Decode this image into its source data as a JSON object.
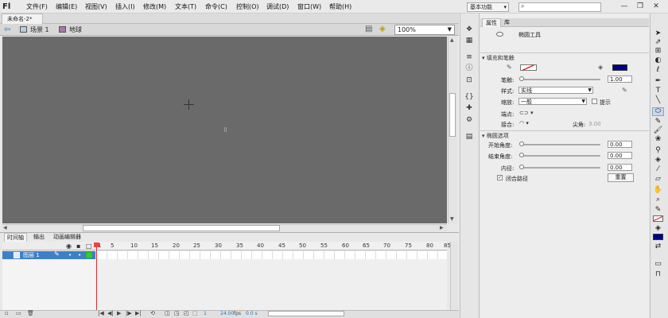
{
  "app": {
    "logo": "Fl"
  },
  "menu": [
    "文件(F)",
    "编辑(E)",
    "视图(V)",
    "插入(I)",
    "修改(M)",
    "文本(T)",
    "命令(C)",
    "控制(O)",
    "调试(D)",
    "窗口(W)",
    "帮助(H)"
  ],
  "header": {
    "workspace": "基本功能",
    "search_placeholder": ""
  },
  "window_controls": {
    "minimize": "—",
    "restore": "❐",
    "close": "✕"
  },
  "document": {
    "tab": "未命名-2*"
  },
  "editbar": {
    "scene": "场景 1",
    "symbol": "地球",
    "zoom": "100%"
  },
  "timeline": {
    "tabs": [
      "时间轴",
      "输出",
      "动画编辑器"
    ],
    "ruler": [
      "1",
      "5",
      "10",
      "15",
      "20",
      "25",
      "30",
      "35",
      "40",
      "45",
      "50",
      "55",
      "60",
      "65",
      "70",
      "75",
      "80",
      "85"
    ],
    "layer_name": "图层 1",
    "current_frame": "1",
    "fps": "24.00",
    "fps_unit": "fps",
    "elapsed": "0.0 s"
  },
  "properties": {
    "tabs": [
      "属性",
      "库"
    ],
    "tool_name": "椭圆工具",
    "section_fill_stroke": "填充和笔触",
    "stroke_label": "笔触:",
    "stroke_value": "1.00",
    "style_label": "样式:",
    "style_value": "实线",
    "scale_label": "缩放:",
    "scale_value": "一般",
    "hint_label": "提示",
    "cap_label": "端点:",
    "join_label": "接合:",
    "miter_label": "尖角:",
    "miter_value": "3.00",
    "section_ellipse": "椭圆选项",
    "start_angle_label": "开始角度:",
    "start_angle_value": "0.00",
    "end_angle_label": "结束角度:",
    "end_angle_value": "0.00",
    "inner_radius_label": "内径:",
    "inner_radius_value": "0.00",
    "close_path_label": "闭合路径",
    "reset_label": "重置",
    "stroke_color": "#ff0000",
    "fill_color": "#00008b"
  }
}
